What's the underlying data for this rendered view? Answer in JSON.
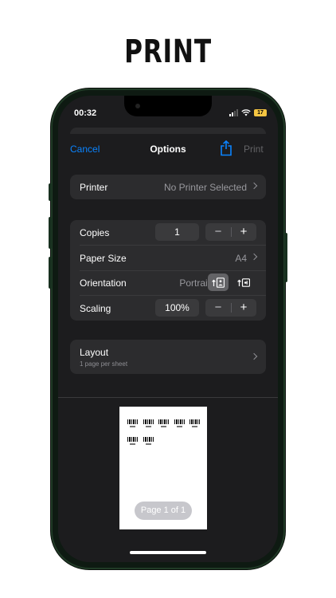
{
  "headline": "PRINT",
  "status_bar": {
    "time": "00:32",
    "battery": "17"
  },
  "nav": {
    "cancel": "Cancel",
    "title": "Options",
    "print": "Print",
    "share_icon": "share-icon"
  },
  "printer_group": {
    "label": "Printer",
    "value": "No Printer Selected"
  },
  "settings": {
    "copies": {
      "label": "Copies",
      "value": "1",
      "minus": "−",
      "plus": "+"
    },
    "paper_size": {
      "label": "Paper Size",
      "value": "A4"
    },
    "orientation": {
      "label": "Orientation",
      "value": "Portrait",
      "selected": "portrait"
    },
    "scaling": {
      "label": "Scaling",
      "value": "100%",
      "minus": "−",
      "plus": "+"
    }
  },
  "layout": {
    "label": "Layout",
    "sub": "1 page per sheet"
  },
  "preview": {
    "page_indicator": "Page 1 of 1",
    "barcode_count": 7
  },
  "colors": {
    "accent": "#0a84ff",
    "background": "#1c1c1e",
    "group": "#2c2c2e"
  }
}
